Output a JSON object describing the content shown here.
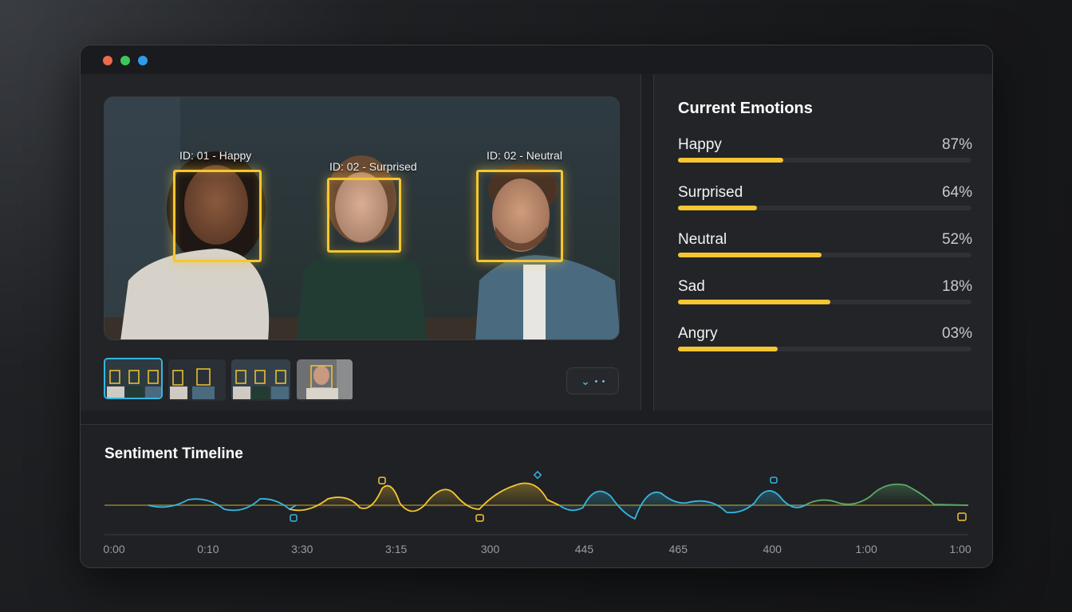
{
  "window": {
    "controls": [
      "close",
      "minimize",
      "maximize"
    ]
  },
  "video": {
    "faces": [
      {
        "label": "ID: 01 - Happy"
      },
      {
        "label": "ID: 02 - Surprised"
      },
      {
        "label": "ID: 02 - Neutral"
      }
    ],
    "thumbnails": [
      {
        "label": ""
      },
      {
        "label": ""
      },
      {
        "label": ""
      },
      {
        "label": ""
      }
    ],
    "more_icon": "chevron-down-icon"
  },
  "emotions": {
    "title": "Current Emotions",
    "items": [
      {
        "name": "Happy",
        "value": "87%",
        "bar_fraction": 0.36
      },
      {
        "name": "Surprised",
        "value": "64%",
        "bar_fraction": 0.27
      },
      {
        "name": "Neutral",
        "value": "52%",
        "bar_fraction": 0.49
      },
      {
        "name": "Sad",
        "value": "18%",
        "bar_fraction": 0.52
      },
      {
        "name": "Angry",
        "value": "03%",
        "bar_fraction": 0.34
      }
    ]
  },
  "timeline": {
    "title": "Sentiment Timeline",
    "ticks": [
      "0:00",
      "0:10",
      "3:30",
      "3:15",
      "300",
      "445",
      "465",
      "400",
      "1:00",
      "1:00"
    ]
  },
  "colors": {
    "accent": "#f5c631",
    "cyan": "#35b6e0",
    "green": "#5fa86a"
  }
}
